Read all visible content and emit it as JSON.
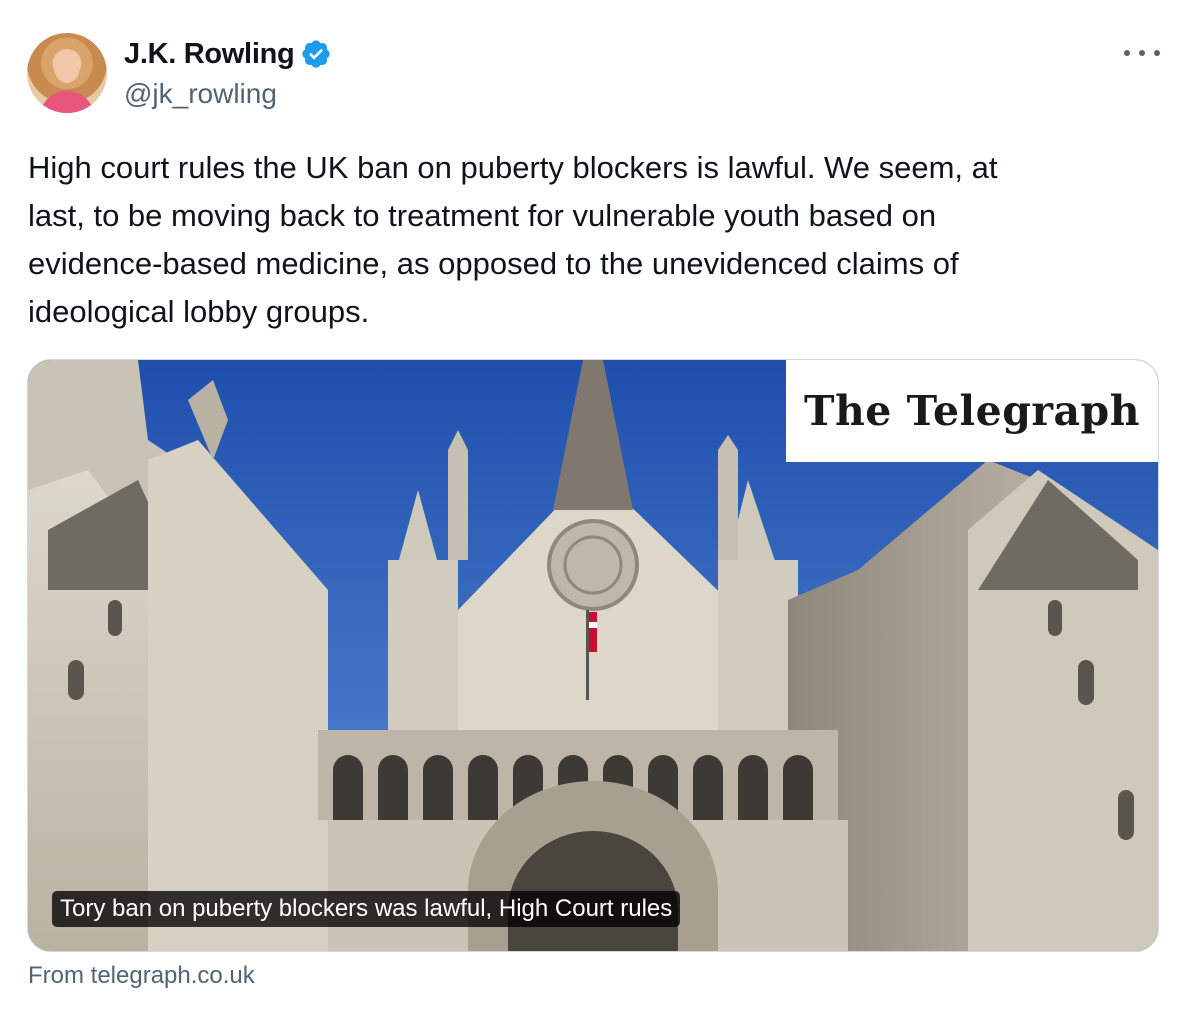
{
  "author": {
    "display_name": "J.K. Rowling",
    "handle": "@jk_rowling",
    "verified": true,
    "avatar_icon": "profile-photo"
  },
  "more_icon": "more-horizontal-icon",
  "tweet": {
    "text": "High court rules the UK ban on puberty blockers is lawful. We seem, at\nlast, to be moving back to treatment for vulnerable youth based on\nevidence-based medicine, as opposed to the unevidenced claims of\nideological lobby groups."
  },
  "card": {
    "publisher_logo_text": "The Telegraph",
    "image_subject": "Royal Courts of Justice facade under blue sky",
    "caption": "Tory ban on puberty blockers was lawful, High Court rules",
    "source": "From telegraph.co.uk"
  },
  "colors": {
    "text_primary": "#0f1419",
    "text_secondary": "#536471",
    "verified_blue": "#1d9bf0",
    "card_border": "#cfd9de",
    "sky": "#2f5fb7"
  }
}
